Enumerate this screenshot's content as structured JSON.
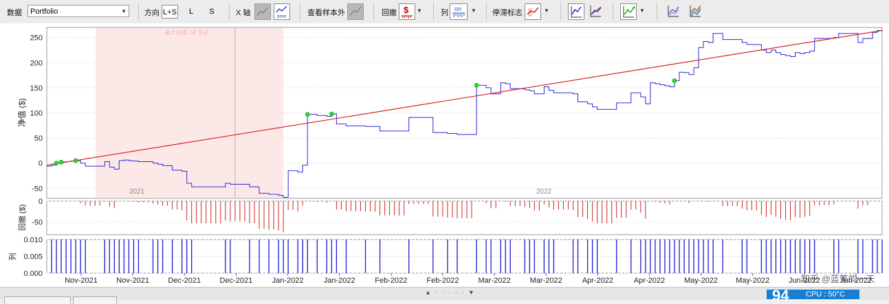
{
  "toolbar": {
    "data_label": "数据",
    "data_value": "Portfolio",
    "direction_label": "方向",
    "dir_options": [
      "L+S",
      "L",
      "S"
    ],
    "xaxis_label": "X 轴",
    "oos_label": "查看样本外",
    "drawdown_label": "回撤",
    "column_label": "列",
    "column_icon_text": "on",
    "stagnation_label": "停滞标志"
  },
  "chart_data": [
    {
      "type": "line",
      "ylabel": "净值 ($)",
      "ylim": [
        -70,
        270
      ],
      "yticks": [
        -50,
        0,
        50,
        100,
        150,
        200,
        250
      ],
      "year_labels": [
        "2021",
        "2022"
      ],
      "shaded_annotation": "最大停滞: 58 天前",
      "series": [
        {
          "color": "#2a2ad4",
          "values": [
            -6,
            -4,
            0,
            2,
            3,
            4,
            5,
            0,
            -6,
            -6,
            -6,
            -6,
            3,
            -8,
            -12,
            5,
            6,
            5,
            4,
            3,
            3,
            3,
            0,
            -2,
            -5,
            -5,
            -14,
            -14,
            -16,
            -40,
            -47,
            -47,
            -47,
            -47,
            -47,
            -47,
            -47,
            -40,
            -42,
            -42,
            -42,
            -42,
            -47,
            -47,
            -60,
            -60,
            -62,
            -62,
            -64,
            -68,
            -15,
            -15,
            -18,
            -4,
            97,
            97,
            95,
            95,
            93,
            98,
            78,
            78,
            74,
            74,
            74,
            74,
            73,
            73,
            73,
            64,
            64,
            64,
            64,
            64,
            64,
            91,
            91,
            91,
            91,
            91,
            61,
            61,
            61,
            59,
            59,
            57,
            57,
            57,
            57,
            155,
            155,
            150,
            138,
            138,
            160,
            158,
            148,
            148,
            148,
            146,
            144,
            138,
            138,
            152,
            145,
            140,
            140,
            140,
            140,
            138,
            122,
            122,
            118,
            112,
            107,
            107,
            107,
            107,
            120,
            120,
            120,
            140,
            140,
            132,
            118,
            160,
            158,
            156,
            154,
            152,
            164,
            181,
            180,
            176,
            190,
            230,
            242,
            240,
            258,
            258,
            246,
            246,
            246,
            246,
            240,
            236,
            236,
            236,
            225,
            220,
            225,
            220,
            216,
            214,
            212,
            220,
            218,
            220,
            223,
            248,
            248,
            248,
            248,
            250,
            258,
            258,
            258,
            258,
            240,
            248,
            248,
            260,
            264,
            262
          ]
        },
        {
          "color": "#dd2222",
          "values": [
            -4,
            264
          ]
        }
      ],
      "markers_y": [
        3,
        5,
        8,
        97,
        97,
        155,
        164,
        165,
        180,
        190,
        225,
        242,
        258,
        260,
        262
      ]
    },
    {
      "type": "bar",
      "ylabel": "回撤 ($)",
      "ylim": [
        -80,
        0
      ],
      "yticks": [
        0,
        -50
      ],
      "color": "#cc2222"
    },
    {
      "type": "bar",
      "ylabel": "列",
      "ylim": [
        0,
        0.01
      ],
      "yticks": [
        "0.010",
        "0.005",
        "0.000"
      ],
      "color": "#1a1ad0",
      "categories": [
        "Nov-2021",
        "Nov-2021",
        "Dec-2021",
        "Dec-2021",
        "Jan-2022",
        "Jan-2022",
        "Feb-2022",
        "Feb-2022",
        "Mar-2022",
        "Mar-2022",
        "Apr-2022",
        "Apr-2022",
        "May-2022",
        "May-2022",
        "Jun-2022",
        "Jun-2022"
      ]
    }
  ],
  "footer": {
    "scroll_arrows": "▲ · · · · · ▼",
    "cpu_value": "94",
    "cpu_text": "CPU : 50°C"
  },
  "watermark": "知乎 @蓝筹的一天"
}
